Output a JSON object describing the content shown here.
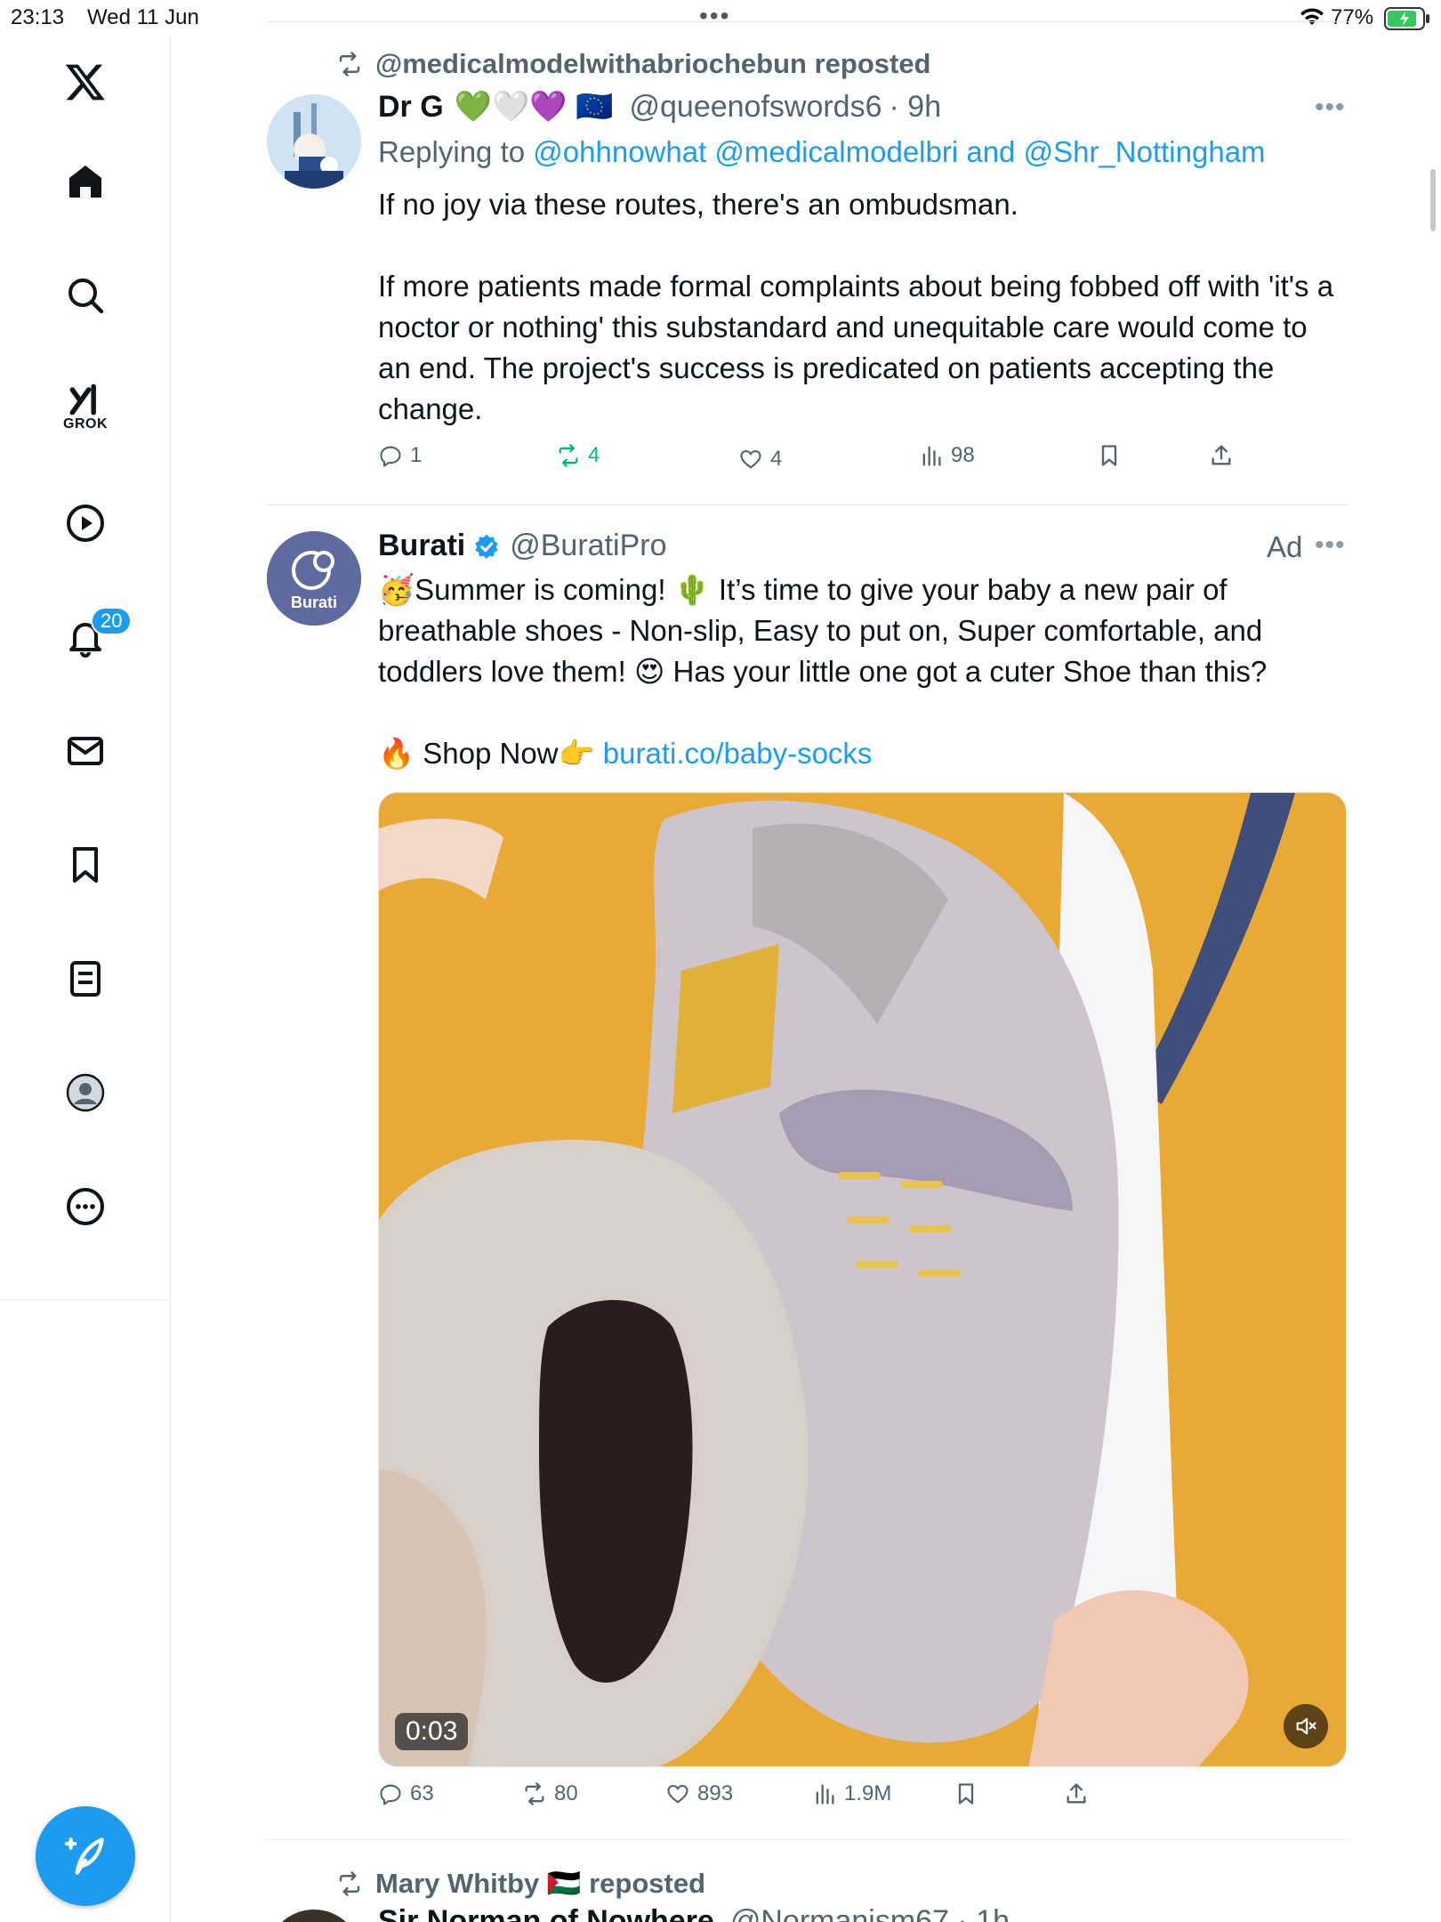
{
  "status_bar": {
    "time": "23:13",
    "date": "Wed 11 Jun",
    "battery": "77%"
  },
  "sidebar": {
    "grok_label": "GROK",
    "notifications_badge": "20"
  },
  "tweets": [
    {
      "repost_by": "@medicalmodelwithabriochebun reposted",
      "name": "Dr G",
      "name_emoji": "💚🤍💜 🇪🇺",
      "handle": "@queenofswords6",
      "time": "· 9h",
      "replying_prefix": "Replying to",
      "replying_to": "@ohhnowhat @medicalmodelbri and @Shr_Nottingham",
      "text_p1": "If no joy via these routes, there's an ombudsman.",
      "text_p2": "If more patients made formal complaints about being fobbed off with 'it's a noctor or nothing' this substandard and unequitable care would come to an end. The project's success is predicated on patients accepting the change.",
      "replies": "1",
      "reposts": "4",
      "likes": "4",
      "views": "98"
    },
    {
      "name": "Burati",
      "handle": "@BuratiPro",
      "ad_label": "Ad",
      "avatar_text": "Burati",
      "text_p1": "🥳Summer is coming! 🌵 It’s time to give your baby a new pair of breathable shoes - Non-slip, Easy to put on, Super comfortable, and toddlers love them! 😍 Has your little one got a cuter Shoe than this?",
      "shop_prefix": "🔥 Shop Now👉",
      "shop_link": "burati.co/baby-socks",
      "video_duration": "0:03",
      "replies": "63",
      "reposts": "80",
      "likes": "893",
      "views": "1.9M"
    },
    {
      "repost_by": "Mary Whitby 🇵🇸 reposted",
      "name": "Sir Norman of Nowhere",
      "handle": "@Normanism67 · 1h"
    }
  ],
  "colors": {
    "accent": "#1d9bf0",
    "repost_green": "#00ba7c",
    "secondary_text": "#536471"
  }
}
